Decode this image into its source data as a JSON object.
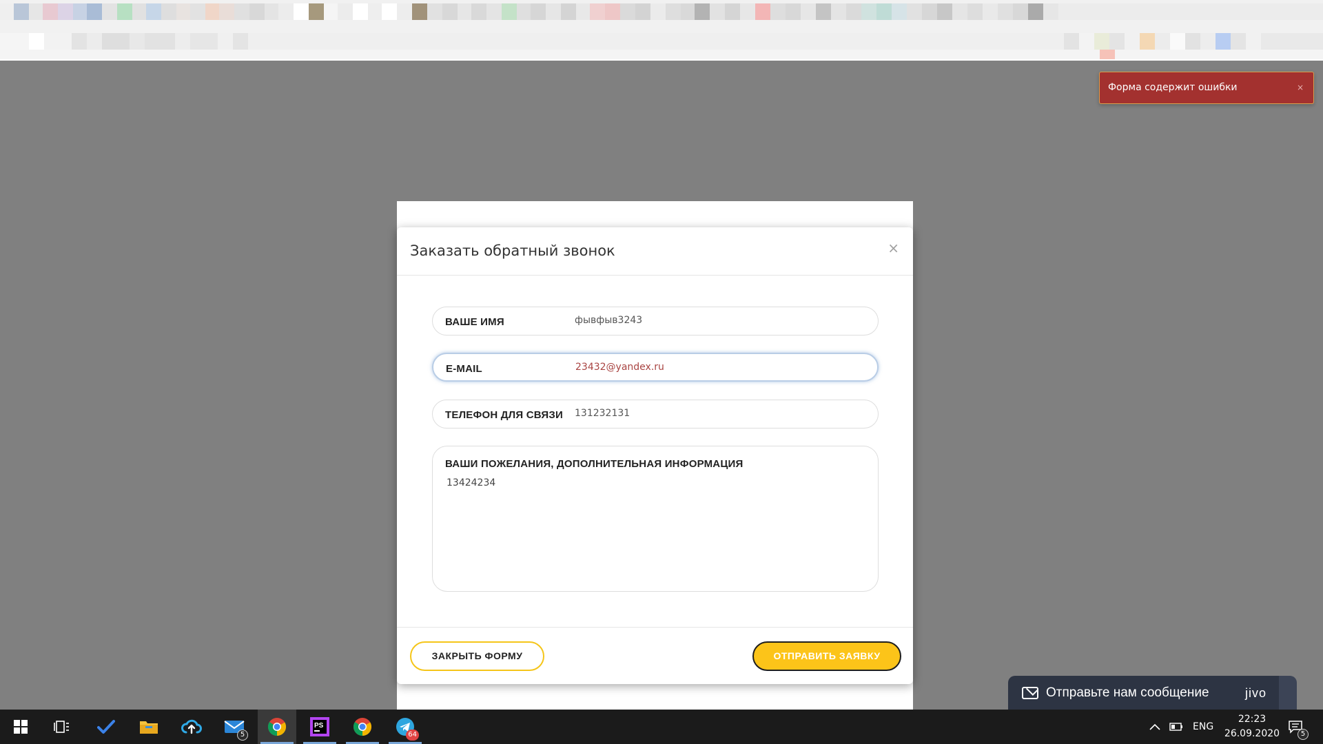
{
  "modal": {
    "title": "Заказать обратный звонок",
    "close_glyph": "×",
    "fields": {
      "name": {
        "label": "ВАШЕ ИМЯ",
        "value": "фывфыв3243"
      },
      "email": {
        "label": "E-MAIL",
        "value": "23432@yandex.ru"
      },
      "phone": {
        "label": "ТЕЛЕФОН ДЛЯ СВЯЗИ",
        "value": "131232131"
      },
      "comment": {
        "label": "ВАШИ ПОЖЕЛАНИЯ, ДОПОЛНИТЕЛЬНАЯ ИНФОРМАЦИЯ",
        "value": "13424234"
      }
    },
    "buttons": {
      "close_label": "ЗАКРЫТЬ ФОРМУ",
      "submit_label": "ОТПРАВИТЬ ЗАЯВКУ"
    }
  },
  "toast": {
    "message": "Форма содержит ошибки",
    "close_glyph": "×"
  },
  "jivo": {
    "text": "Отправьте нам сообщение",
    "logo": "jivo"
  },
  "taskbar": {
    "apps": [
      {
        "icon": "windows-start-icon"
      },
      {
        "icon": "task-view-icon"
      },
      {
        "icon": "todo-check-icon"
      },
      {
        "icon": "file-explorer-icon"
      },
      {
        "icon": "cloud-sync-icon"
      },
      {
        "icon": "mail-icon",
        "badge": "5"
      },
      {
        "icon": "chrome-icon"
      },
      {
        "icon": "phpstorm-icon",
        "label": "PS"
      },
      {
        "icon": "chrome-icon"
      },
      {
        "icon": "telegram-icon",
        "badge": "64"
      }
    ],
    "tray": {
      "language": "ENG",
      "time": "22:23",
      "date": "26.09.2020",
      "notifications_badge": "5"
    }
  },
  "colors": {
    "overlay": "#808080",
    "accent_yellow": "#fcc419",
    "error_red": "#a3312f",
    "error_text": "#a94442",
    "jivo_bg": "#2d3443",
    "taskbar_bg": "#1b1b1b"
  }
}
